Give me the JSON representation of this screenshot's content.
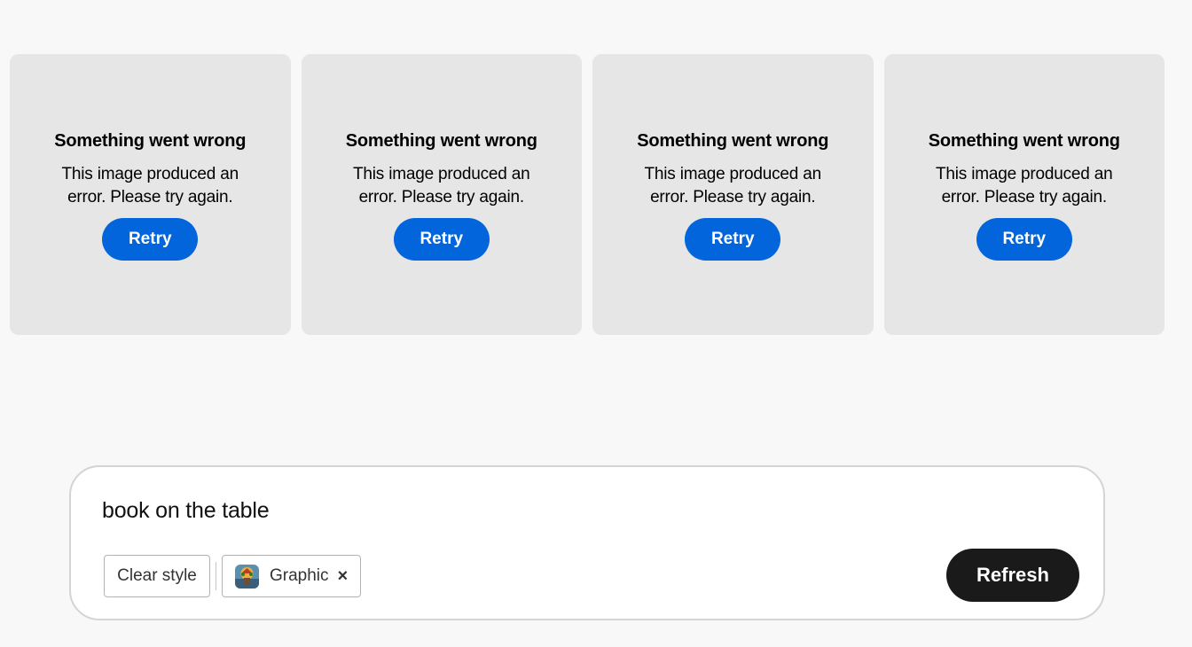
{
  "cards": [
    {
      "title": "Something went wrong",
      "message": "This image produced an error. Please try again.",
      "button": "Retry"
    },
    {
      "title": "Something went wrong",
      "message": "This image produced an error. Please try again.",
      "button": "Retry"
    },
    {
      "title": "Something went wrong",
      "message": "This image produced an error. Please try again.",
      "button": "Retry"
    },
    {
      "title": "Something went wrong",
      "message": "This image produced an error. Please try again.",
      "button": "Retry"
    }
  ],
  "prompt": {
    "text": "book on the table",
    "clear_style_label": "Clear style",
    "style_chip_label": "Graphic",
    "style_chip_icon": "graphic-style-thumbnail",
    "refresh_label": "Refresh"
  },
  "colors": {
    "accent_blue": "#0265dc",
    "refresh_bg": "#1a1a1a",
    "card_bg": "#e6e6e6",
    "page_bg": "#f8f8f8"
  }
}
